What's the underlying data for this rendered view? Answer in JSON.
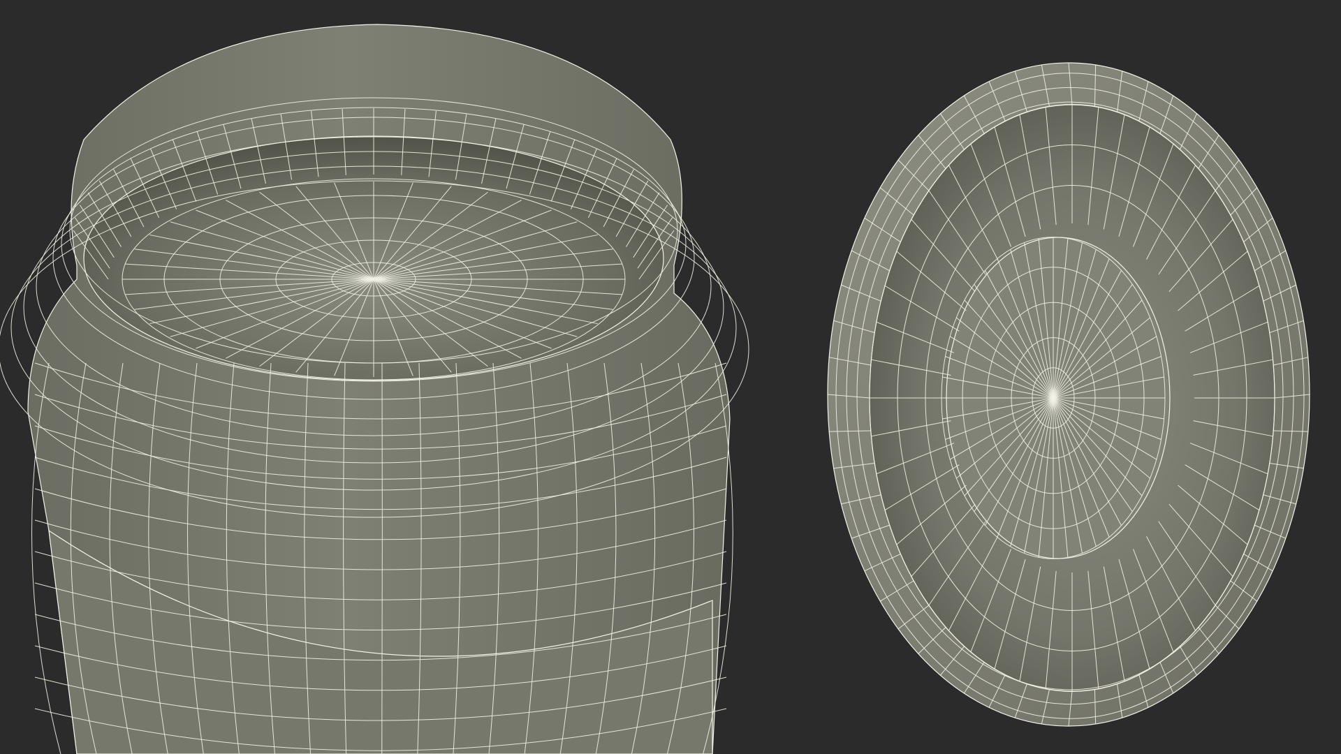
{
  "scene": {
    "background_color": "#2b2b2b",
    "surface_color": "#7b7c70",
    "wire_color": "#f2f2e6",
    "objects": [
      {
        "name": "jar-body",
        "kind": "wireframe-jar"
      },
      {
        "name": "jar-lid",
        "kind": "wireframe-lid"
      }
    ]
  }
}
